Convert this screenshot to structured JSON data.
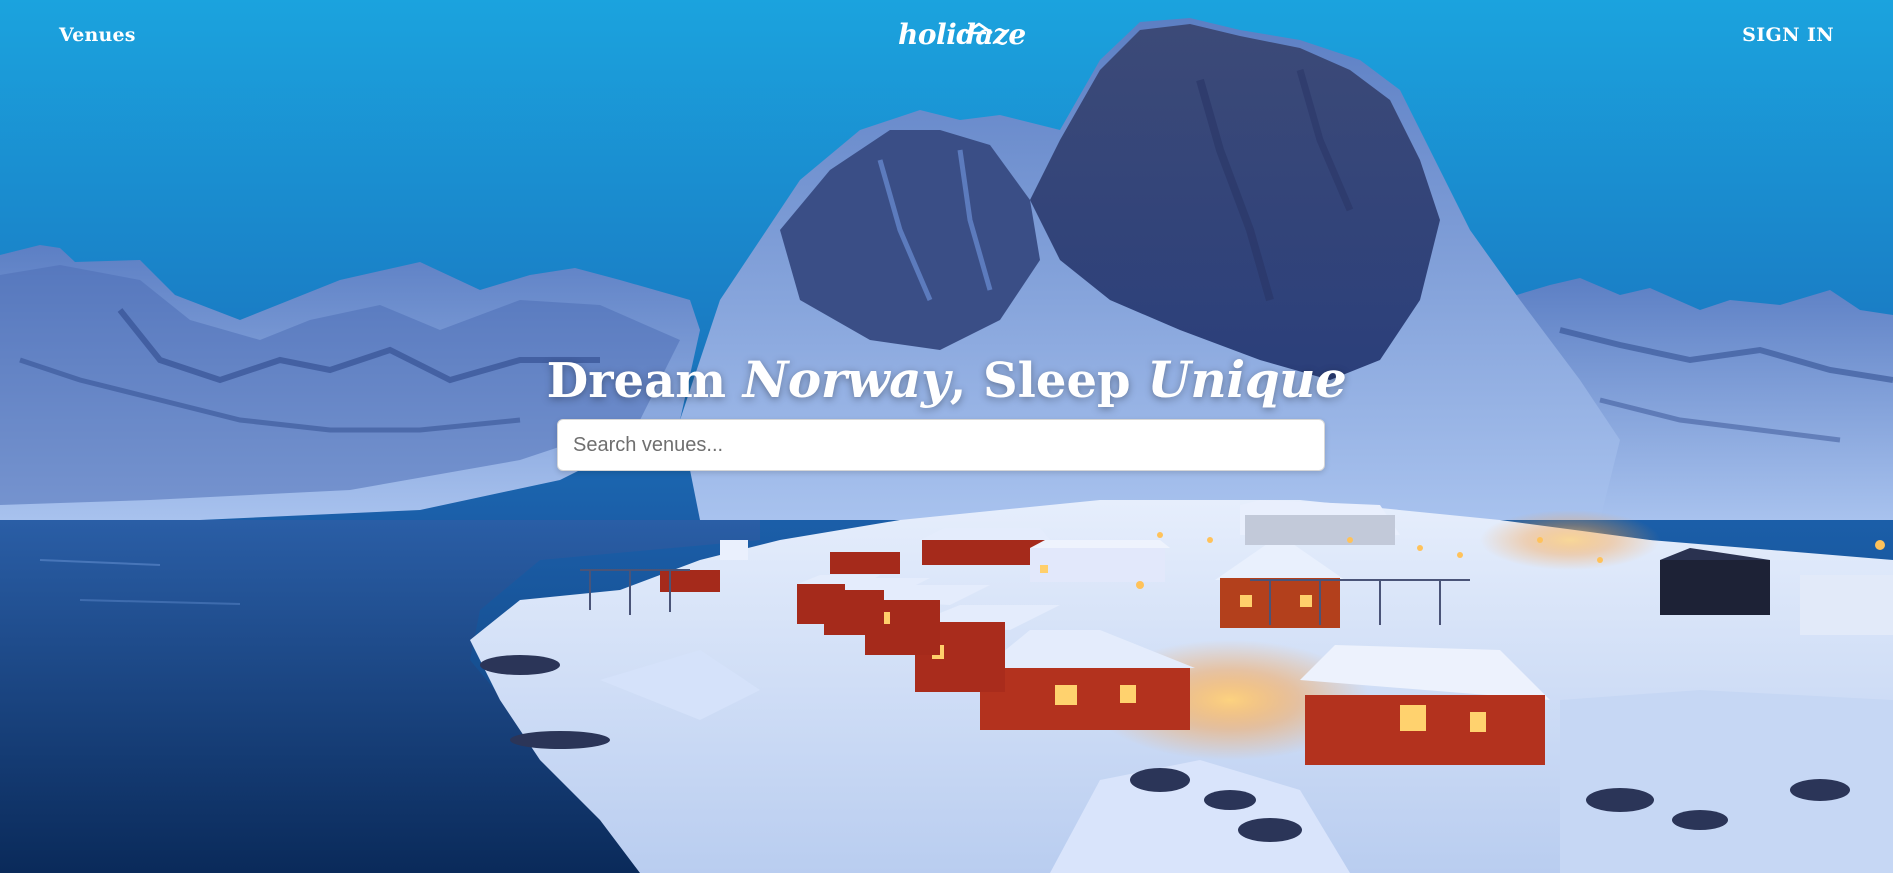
{
  "nav": {
    "venues_label": "Venues",
    "logo_text": "holidaze",
    "signin_label": "SIGN IN"
  },
  "hero": {
    "headline_part1": "Dream ",
    "headline_part2": "Norway",
    "headline_part3": ", Sleep ",
    "headline_part4": "Unique"
  },
  "search": {
    "placeholder": "Search venues...",
    "value": ""
  },
  "icons": {
    "logo": "house-roof-icon"
  },
  "colors": {
    "sky_top": "#1aa0dc",
    "sky_bottom": "#174e8e",
    "text": "#ffffff",
    "cabin_red": "#b8321e",
    "light_glow": "#ffb347"
  }
}
